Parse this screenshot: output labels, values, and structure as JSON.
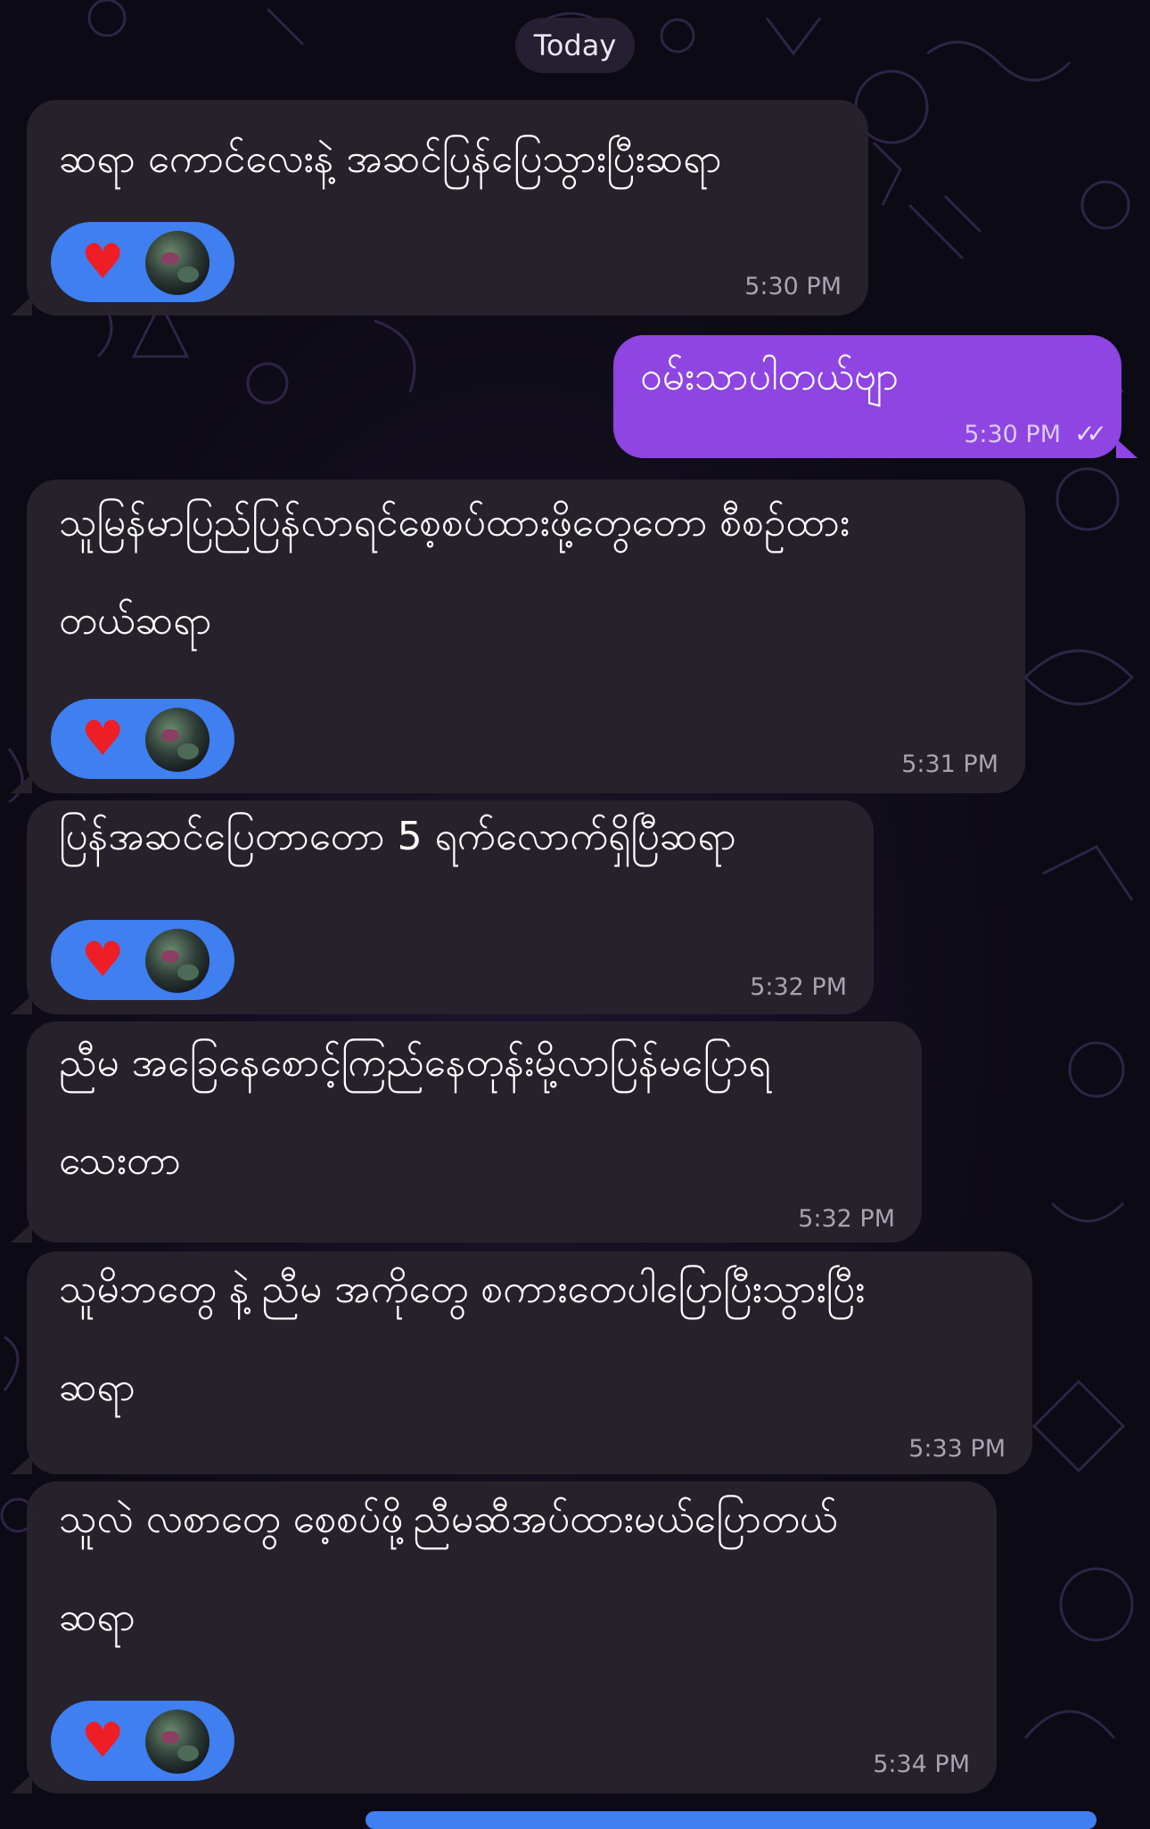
{
  "date_separator": "Today",
  "messages": [
    {
      "text": "ဆရာ ကောင်လေးနဲ့ အဆင်ပြန်ပြေသွားပြီးဆရာ",
      "time": "5:30 PM",
      "direction": "incoming",
      "reaction": "heart"
    },
    {
      "text": "ဝမ်းသာပါတယ်ဗျာ",
      "time": "5:30 PM",
      "direction": "outgoing",
      "read": true
    },
    {
      "text": "သူမြန်မာပြည်ပြန်လာရင်စေ့စပ်ထားဖို့တွေတော စီစဉ်ထား\nတယ်ဆရာ",
      "time": "5:31 PM",
      "direction": "incoming",
      "reaction": "heart"
    },
    {
      "text": "ပြန်အဆင်ပြေတာတော 5 ရက်လောက်ရှိပြီဆရာ",
      "time": "5:32 PM",
      "direction": "incoming",
      "reaction": "heart"
    },
    {
      "text": "ညီမ အခြေနေစောင့်ကြည်နေတုန်းမို့လာပြန်မပြောရ\nသေးတာ",
      "time": "5:32 PM",
      "direction": "incoming"
    },
    {
      "text": "သူမိဘတွေ နဲ့ ညီမ အကိုတွေ စကားတေပါပြောပြီးသွားပြီး\nဆရာ",
      "time": "5:33 PM",
      "direction": "incoming"
    },
    {
      "text": "သူလဲ လစာတွေ စေ့စပ်ဖို့ညီမဆီအပ်ထားမယ်ပြောတယ်\nဆရာ",
      "time": "5:34 PM",
      "direction": "incoming",
      "reaction": "heart"
    }
  ],
  "colors": {
    "background": "#0c0a14",
    "incoming_bubble": "#28222c",
    "outgoing_bubble": "#8e45e2",
    "reaction_pill": "#3f7fef",
    "heart": "#ef1d24"
  },
  "icons": {
    "reaction": "heart-icon",
    "read_receipt": "double-check-icon"
  }
}
